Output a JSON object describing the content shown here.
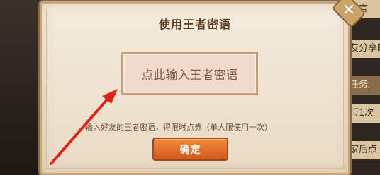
{
  "dialog": {
    "title": "使用王者密语",
    "input_placeholder": "点此输入王者密语",
    "hint": "输入好友的王者密语，得限时点券（单人限使用一次）",
    "confirm_label": "确定",
    "close_glyph": "✕"
  },
  "background_strip": {
    "items": [
      "语言",
      "友分享邮",
      "任务",
      "币1次",
      "家后点"
    ]
  },
  "colors": {
    "annotation_arrow": "#e2231a",
    "confirm_button": "#e06a2a",
    "title_text": "#5a3c22"
  }
}
